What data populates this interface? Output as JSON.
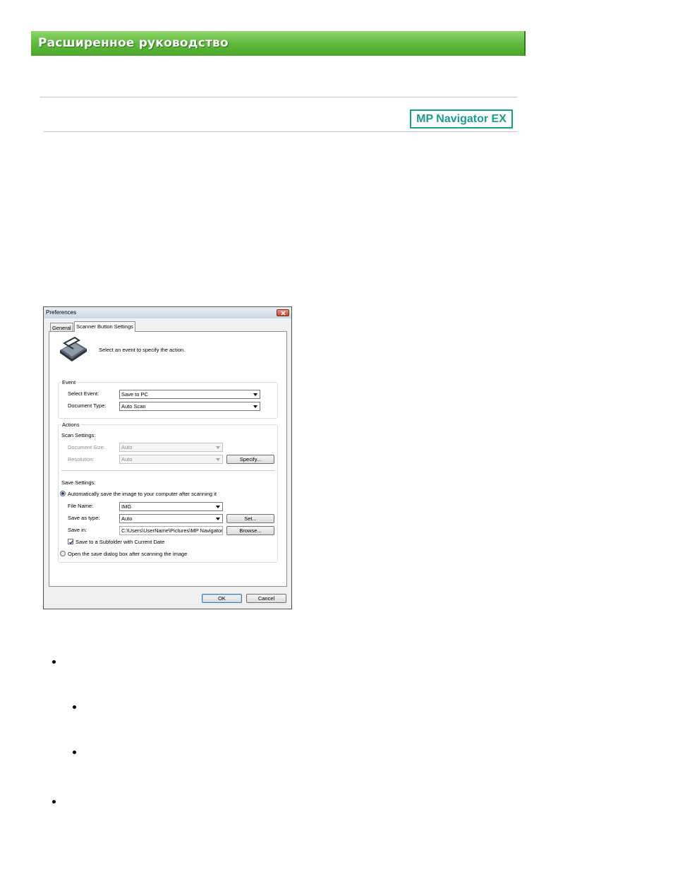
{
  "header": {
    "title": "Расширенное руководство",
    "product_logo": "MP Navigator EX",
    "banner_color": "#5db83a",
    "logo_color": "#1aa08a"
  },
  "dialog": {
    "title": "Preferences",
    "close_icon": "close-icon",
    "tabs": [
      {
        "label": "General",
        "active": false
      },
      {
        "label": "Scanner Button Settings",
        "active": true
      }
    ],
    "icon": "scanner-icon",
    "intro": "Select an event to specify the action.",
    "event_group": {
      "title": "Event",
      "select_event_label": "Select Event:",
      "select_event_value": "Save to PC",
      "document_type_label": "Document Type:",
      "document_type_value": "Auto Scan"
    },
    "actions_group": {
      "title": "Actions",
      "scan_settings_label": "Scan Settings:",
      "document_size_label": "Document Size:",
      "document_size_value": "Auto",
      "resolution_label": "Resolution:",
      "resolution_value": "Auto",
      "specify_button": "Specify...",
      "save_settings_label": "Save Settings:",
      "auto_save_radio": "Automatically save the image to your computer after scanning it",
      "auto_save_selected": true,
      "file_name_label": "File Name:",
      "file_name_value": "IMG",
      "save_as_type_label": "Save as type:",
      "save_as_type_value": "Auto",
      "set_button": "Set...",
      "save_in_label": "Save in:",
      "save_in_value": "C:\\Users\\UserName\\Pictures\\MP Navigator EX",
      "browse_button": "Browse...",
      "subfolder_checkbox": "Save to a Subfolder with Current Date",
      "subfolder_checked": true,
      "open_dialog_radio": "Open the save dialog box after scanning the image",
      "open_dialog_selected": false
    },
    "ok_button": "OK",
    "cancel_button": "Cancel"
  }
}
